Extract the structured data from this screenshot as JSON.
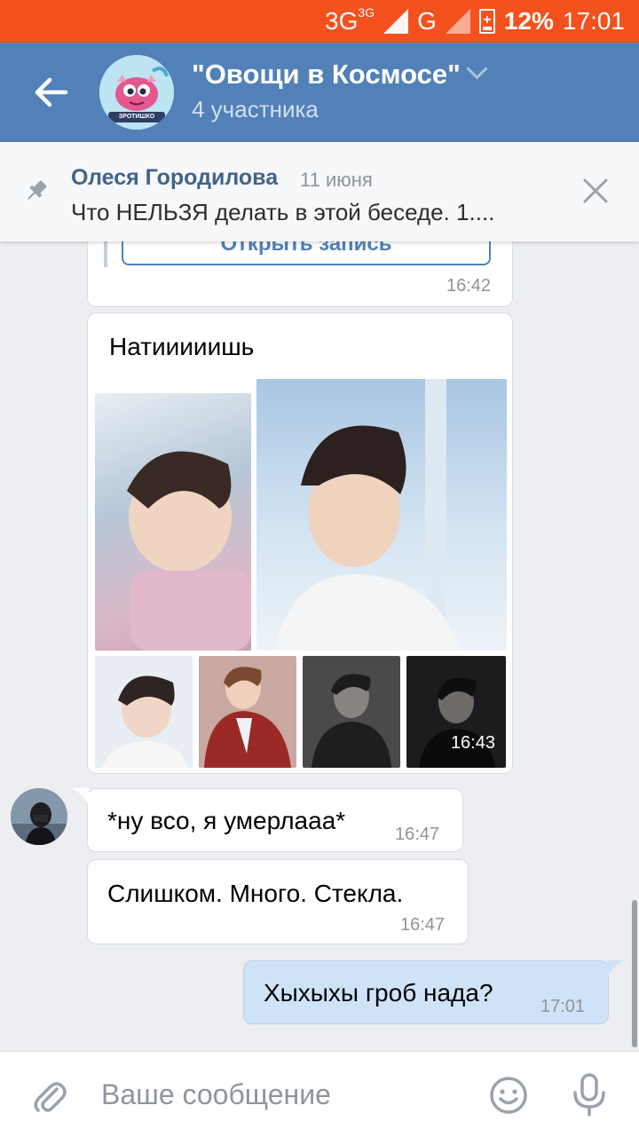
{
  "status_bar": {
    "network_1": "3G",
    "network_1_sup": "3G",
    "network_2": "G",
    "battery": "12%",
    "time": "17:01"
  },
  "header": {
    "title": "\"Овощи в Космосе\"",
    "subtitle": "4 участника",
    "avatar_caption": "ЗРОТИШКО"
  },
  "pinned": {
    "author": "Олеся Городилова",
    "date": "11 июня",
    "text": "Что НЕЛЬЗЯ делать в этой беседе. 1...."
  },
  "messages": [
    {
      "partial_button": "Открыть запись",
      "time": "16:42"
    },
    {
      "text": "Натииииишь",
      "time": "16:43"
    },
    {
      "text": "*ну всо, я умерлааа*",
      "time": "16:47"
    },
    {
      "text": "Слишком. Много. Стекла.",
      "time": "16:47"
    },
    {
      "text": "Хыхыхы гроб нада?",
      "time": "17:01"
    }
  ],
  "composer": {
    "placeholder": "Ваше сообщение"
  },
  "colors": {
    "status_bar": "#f4511e",
    "header": "#5181b8",
    "outgoing_bubble": "#cfe3f8",
    "background": "#edeef2"
  }
}
